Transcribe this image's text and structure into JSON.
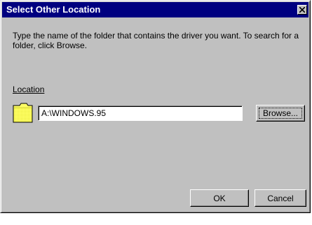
{
  "window": {
    "title": "Select Other Location"
  },
  "instructions": "Type the name of the folder that contains the driver you want. To search for a folder, click Browse.",
  "location": {
    "label": "Location",
    "value": "A:\\WINDOWS.95"
  },
  "buttons": {
    "browse": "Browse...",
    "ok": "OK",
    "cancel": "Cancel"
  },
  "icons": {
    "close": "close-icon",
    "folder": "folder-icon"
  },
  "colors": {
    "titlebar": "#000080",
    "face": "#c0c0c0",
    "folder": "#ffff66"
  }
}
